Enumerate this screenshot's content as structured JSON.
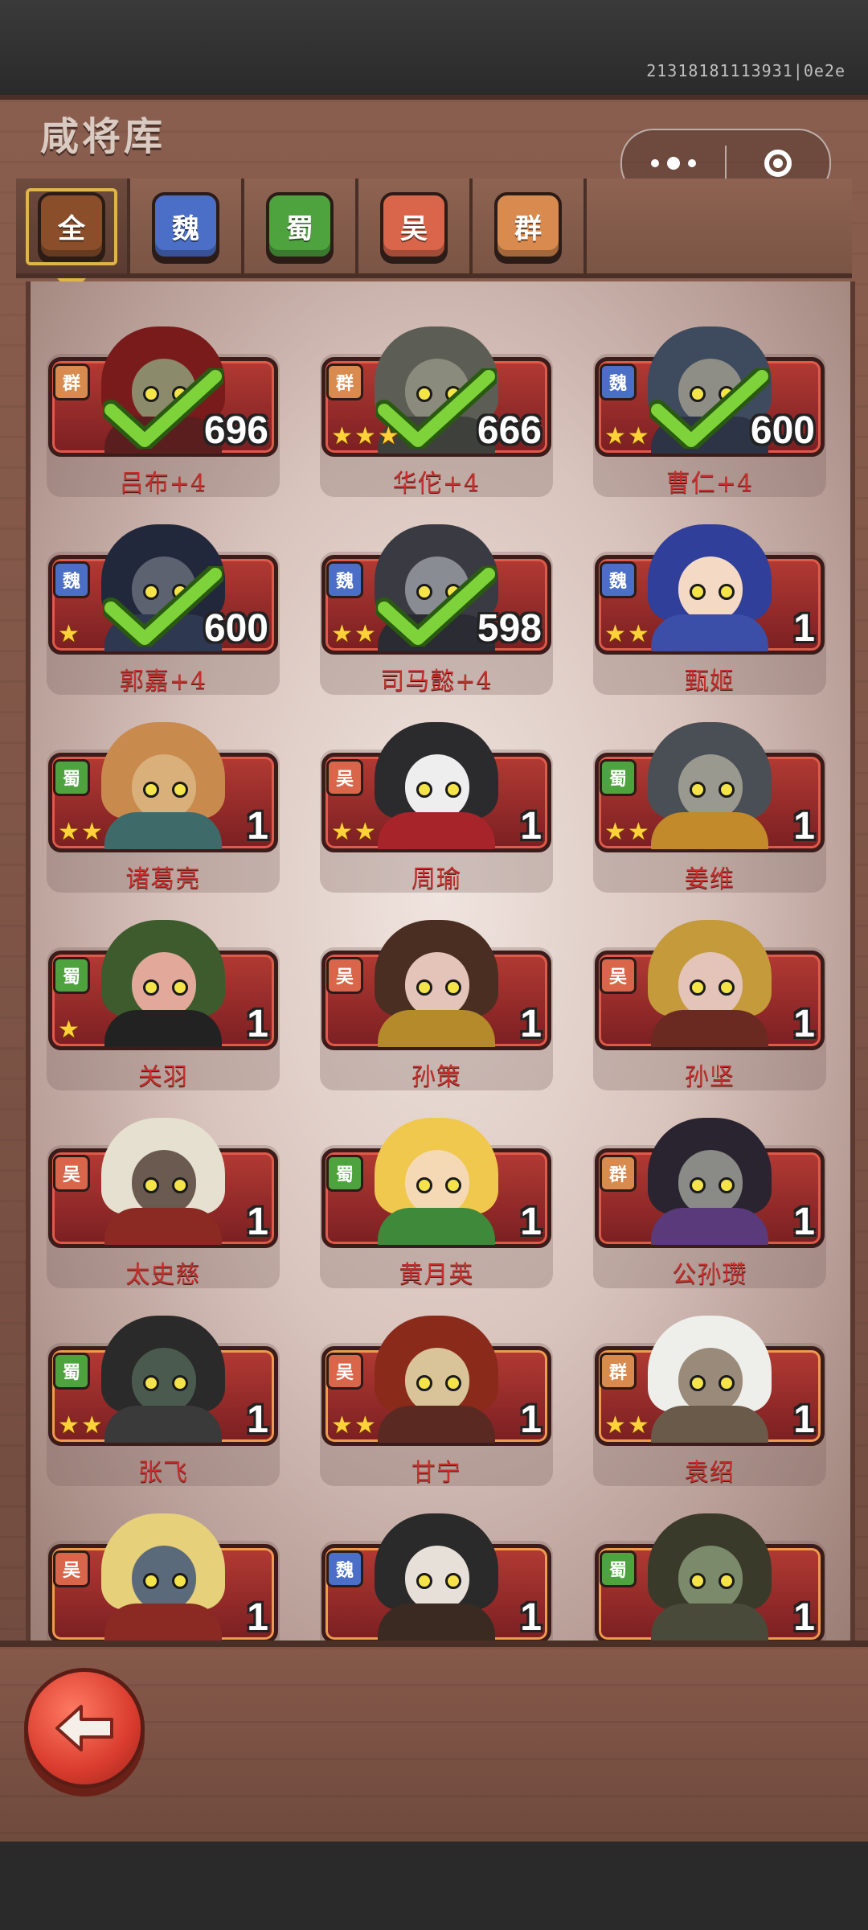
{
  "version": "21318181113931|0e2e",
  "title": "咸将库",
  "tabs": [
    {
      "label": "全",
      "key": "all",
      "active": true
    },
    {
      "label": "魏",
      "key": "wei",
      "active": false
    },
    {
      "label": "蜀",
      "key": "shu",
      "active": false
    },
    {
      "label": "吴",
      "key": "wu",
      "active": false
    },
    {
      "label": "群",
      "key": "qun",
      "active": false
    }
  ],
  "colors": {
    "wei": "#4b6fc7",
    "shu": "#4ea33f",
    "wu": "#d9664b",
    "qun": "#d98a4e",
    "card_red": "#b23a33",
    "name_red": "#c62f2c",
    "star": "#ffd23a",
    "check_green": "#7ed23a"
  },
  "generals": [
    {
      "name": "吕布+4",
      "faction": "群",
      "fkey": "qun",
      "stars": 0,
      "count": "696",
      "checked": true,
      "hair": "#7a1b1b",
      "face": "#8b8a6a",
      "body": "#5b1e1e",
      "frame": "red"
    },
    {
      "name": "华佗+4",
      "faction": "群",
      "fkey": "qun",
      "stars": 3,
      "count": "666",
      "checked": true,
      "hair": "#5c5e55",
      "face": "#8a8b7c",
      "body": "#3e403c",
      "frame": "red"
    },
    {
      "name": "曹仁+4",
      "faction": "魏",
      "fkey": "wei",
      "stars": 2,
      "count": "600",
      "checked": true,
      "hair": "#3e4a5e",
      "face": "#8e8e86",
      "body": "#2c3445",
      "frame": "red"
    },
    {
      "name": "郭嘉+4",
      "faction": "魏",
      "fkey": "wei",
      "stars": 1,
      "count": "600",
      "checked": true,
      "hair": "#22283b",
      "face": "#5c6270",
      "body": "#2e3850",
      "frame": "red"
    },
    {
      "name": "司马懿+4",
      "faction": "魏",
      "fkey": "wei",
      "stars": 2,
      "count": "598",
      "checked": true,
      "hair": "#3a3b42",
      "face": "#8a8c94",
      "body": "#2a2b33",
      "frame": "red"
    },
    {
      "name": "甄姬",
      "faction": "魏",
      "fkey": "wei",
      "stars": 2,
      "count": "1",
      "checked": false,
      "hair": "#2f3f9a",
      "face": "#f4d9c4",
      "body": "#3b4ea8",
      "frame": "red"
    },
    {
      "name": "诸葛亮",
      "faction": "蜀",
      "fkey": "shu",
      "stars": 2,
      "count": "1",
      "checked": false,
      "hair": "#c98a4e",
      "face": "#d9b07a",
      "body": "#3e6a6a",
      "frame": "red"
    },
    {
      "name": "周瑜",
      "faction": "吴",
      "fkey": "wu",
      "stars": 2,
      "count": "1",
      "checked": false,
      "hair": "#2b2b2e",
      "face": "#eeeeee",
      "body": "#a7242a",
      "frame": "red"
    },
    {
      "name": "姜维",
      "faction": "蜀",
      "fkey": "shu",
      "stars": 2,
      "count": "1",
      "checked": false,
      "hair": "#4a4e55",
      "face": "#9a9990",
      "body": "#c28a2a",
      "frame": "red"
    },
    {
      "name": "关羽",
      "faction": "蜀",
      "fkey": "shu",
      "stars": 1,
      "count": "1",
      "checked": false,
      "hair": "#3e5b2e",
      "face": "#e2a89a",
      "body": "#222222",
      "frame": "red"
    },
    {
      "name": "孙策",
      "faction": "吴",
      "fkey": "wu",
      "stars": 0,
      "count": "1",
      "checked": false,
      "hair": "#4a2e22",
      "face": "#e4c4b8",
      "body": "#b58a2a",
      "frame": "red"
    },
    {
      "name": "孙坚",
      "faction": "吴",
      "fkey": "wu",
      "stars": 0,
      "count": "1",
      "checked": false,
      "hair": "#c49a3a",
      "face": "#e4c4b8",
      "body": "#6a2a22",
      "frame": "red"
    },
    {
      "name": "太史慈",
      "faction": "吴",
      "fkey": "wu",
      "stars": 0,
      "count": "1",
      "checked": false,
      "hair": "#e6e0d0",
      "face": "#6a5a50",
      "body": "#8a2a22",
      "frame": "red"
    },
    {
      "name": "黄月英",
      "faction": "蜀",
      "fkey": "shu",
      "stars": 0,
      "count": "1",
      "checked": false,
      "hair": "#f0c84e",
      "face": "#f4d9b4",
      "body": "#3e8a3a",
      "frame": "red"
    },
    {
      "name": "公孙瓒",
      "faction": "群",
      "fkey": "qun",
      "stars": 0,
      "count": "1",
      "checked": false,
      "hair": "#2a2430",
      "face": "#8a8a86",
      "body": "#5a3a7a",
      "frame": "red"
    },
    {
      "name": "张飞",
      "faction": "蜀",
      "fkey": "shu",
      "stars": 2,
      "count": "1",
      "checked": false,
      "hair": "#2a2a2a",
      "face": "#4a5a4e",
      "body": "#3a3a3a",
      "frame": "orange"
    },
    {
      "name": "甘宁",
      "faction": "吴",
      "fkey": "wu",
      "stars": 2,
      "count": "1",
      "checked": false,
      "hair": "#8a2a1a",
      "face": "#d9c49a",
      "body": "#5a2a22",
      "frame": "orange"
    },
    {
      "name": "袁绍",
      "faction": "群",
      "fkey": "qun",
      "stars": 2,
      "count": "1",
      "checked": false,
      "hair": "#eeeeea",
      "face": "#9a8a7a",
      "body": "#6a5a4a",
      "frame": "orange"
    },
    {
      "name": "",
      "faction": "吴",
      "fkey": "wu",
      "stars": 0,
      "count": "1",
      "checked": false,
      "hair": "#e6d07a",
      "face": "#5a6a7a",
      "body": "#8a2a22",
      "frame": "orange"
    },
    {
      "name": "",
      "faction": "魏",
      "fkey": "wei",
      "stars": 0,
      "count": "1",
      "checked": false,
      "hair": "#2a2a2a",
      "face": "#e6e0d8",
      "body": "#3a2a22",
      "frame": "orange"
    },
    {
      "name": "",
      "faction": "蜀",
      "fkey": "shu",
      "stars": 0,
      "count": "1",
      "checked": false,
      "hair": "#3a3a2a",
      "face": "#7a8a6a",
      "body": "#4a4a3a",
      "frame": "orange"
    }
  ]
}
